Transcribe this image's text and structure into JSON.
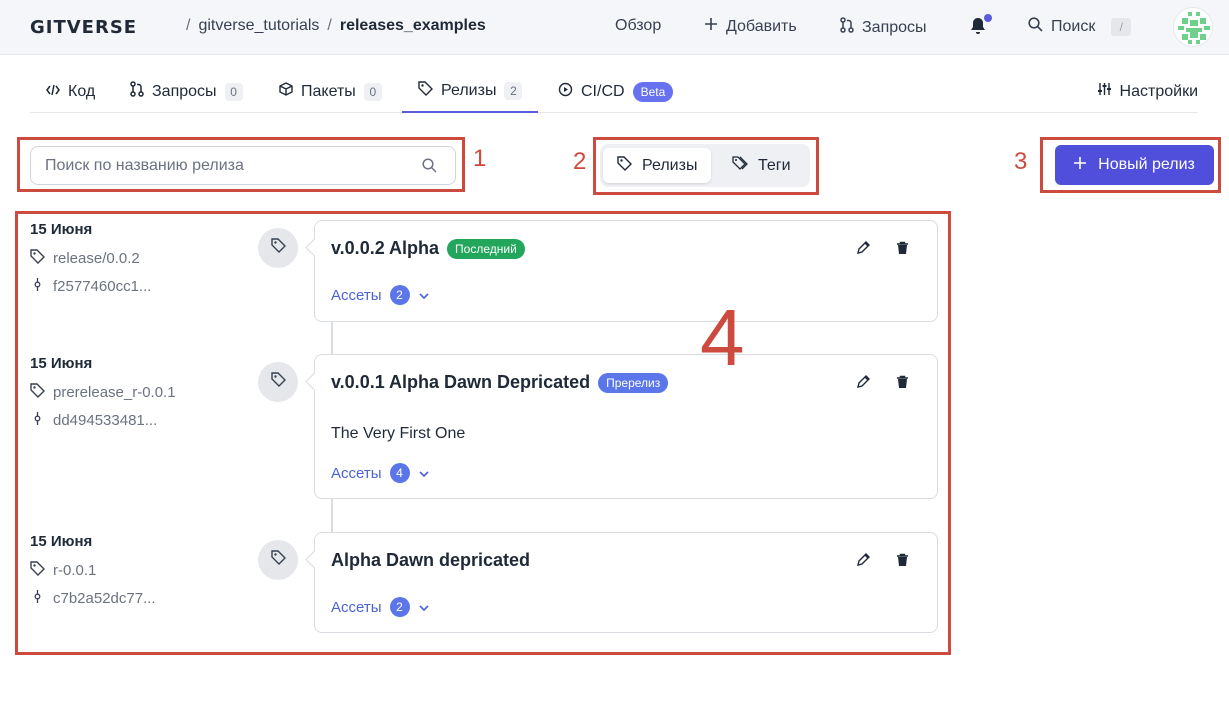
{
  "header": {
    "logo": "GITVERSE",
    "breadcrumb": {
      "owner": "gitverse_tutorials",
      "repo": "releases_examples",
      "separator": "/"
    },
    "nav": {
      "overview": "Обзор",
      "add": "Добавить",
      "requests": "Запросы",
      "search": "Поиск",
      "search_shortcut": "/"
    }
  },
  "tabs": [
    {
      "label": "Код",
      "icon": "code-icon"
    },
    {
      "label": "Запросы",
      "count": "0",
      "icon": "pull-request-icon"
    },
    {
      "label": "Пакеты",
      "count": "0",
      "icon": "package-icon"
    },
    {
      "label": "Релизы",
      "count": "2",
      "icon": "tag-icon",
      "active": true
    },
    {
      "label": "CI/CD",
      "badge": "Beta",
      "icon": "play-circle-icon"
    }
  ],
  "settings_label": "Настройки",
  "search": {
    "placeholder": "Поиск по названию релиза",
    "value": ""
  },
  "segment": {
    "releases": "Релизы",
    "tags": "Теги",
    "active": "releases"
  },
  "new_release_button": "Новый релиз",
  "annotations": {
    "a1": "1",
    "a2": "2",
    "a3": "3",
    "a4": "4"
  },
  "releases": [
    {
      "date": "15 Июня",
      "tag": "release/0.0.2",
      "commit": "f2577460cc1...",
      "title": "v.0.0.2 Alpha",
      "badge": "Последний",
      "badge_color": "#22a65c",
      "description": "",
      "assets_label": "Ассеты",
      "assets_count": "2"
    },
    {
      "date": "15 Июня",
      "tag": "prerelease_r-0.0.1",
      "commit": "dd494533481...",
      "title": "v.0.0.1 Alpha Dawn Depricated",
      "badge": "Пререлиз",
      "badge_color": "#5a76e8",
      "description": "The Very First One",
      "assets_label": "Ассеты",
      "assets_count": "4"
    },
    {
      "date": "15 Июня",
      "tag": "r-0.0.1",
      "commit": "c7b2a52dc77...",
      "title": "Alpha Dawn depricated",
      "badge": "",
      "description": "",
      "assets_label": "Ассеты",
      "assets_count": "2"
    }
  ],
  "colors": {
    "accent": "#4f4fdc",
    "annotation": "#cc4a3e",
    "link": "#4b62d6"
  }
}
